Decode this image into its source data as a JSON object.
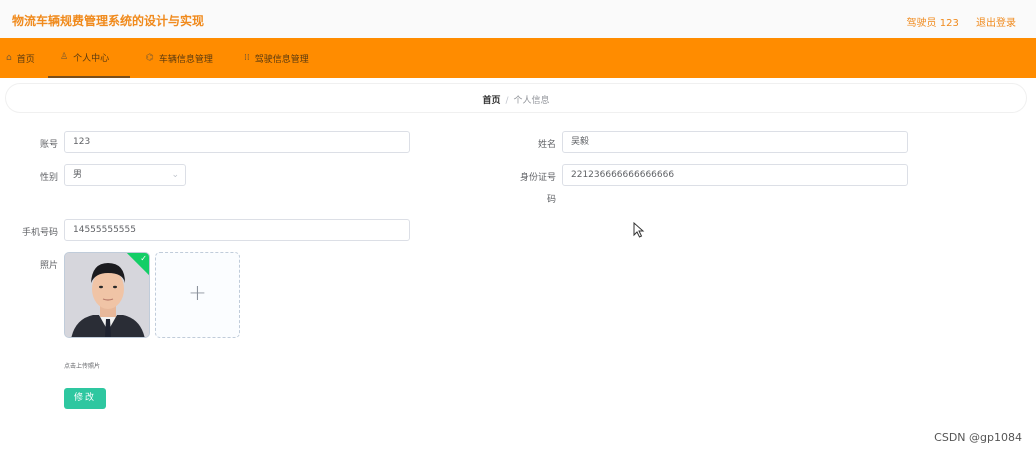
{
  "header": {
    "app_title": "物流车辆规费管理系统的设计与实现",
    "user_label": "驾驶员 123",
    "logout_label": "退出登录"
  },
  "nav": {
    "items": [
      {
        "label": "首页",
        "icon": "home-icon"
      },
      {
        "label": "个人中心",
        "icon": "user-icon"
      },
      {
        "label": "车辆信息管理",
        "icon": "vehicle-icon"
      },
      {
        "label": "驾驶信息管理",
        "icon": "grid-icon"
      }
    ],
    "active_index": 1
  },
  "breadcrumb": {
    "home": "首页",
    "separator": "/",
    "current": "个人信息"
  },
  "form": {
    "account_label": "账号",
    "account_value": "123",
    "name_label": "姓名",
    "name_value": "吴毅",
    "gender_label": "性别",
    "gender_value": "男",
    "id_label_line1": "身份证号",
    "id_label_line2": "码",
    "id_value": "221236666666666666",
    "phone_label": "手机号码",
    "phone_value": "14555555555",
    "photo_label": "照片",
    "upload_tip": "点击上传照片",
    "submit_label": "修改"
  },
  "watermark": "CSDN @gp1084",
  "colors": {
    "brand_orange": "#ff8c00",
    "title_orange": "#f08a1c",
    "button_teal": "#2ec7a0",
    "success_green": "#13ce66"
  }
}
